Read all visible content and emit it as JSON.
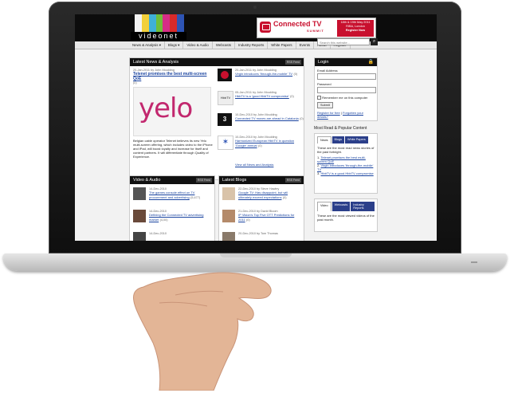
{
  "header": {
    "logo_text": "videonet",
    "logo_colors": [
      "#f3f3f3",
      "#f2d03a",
      "#3fb0d8",
      "#6fbf3a",
      "#d62e86",
      "#d82a2a",
      "#2e54b4"
    ],
    "banner": {
      "title": "Connected TV",
      "subtitle": "SUMMIT",
      "date": "18th & 19th May 2011",
      "venue": "RIBA, London",
      "cta": "Register Now"
    },
    "search_placeholder": "Search this website..."
  },
  "nav": [
    "News & Analysis",
    "Blogs",
    "Video & Audio",
    "Webcasts",
    "Industry Reports",
    "White Papers",
    "Events",
    "About",
    "Register"
  ],
  "latest_news": {
    "heading": "Latest News & Analysis",
    "rss_label": "RSS Feed",
    "featured": {
      "meta": "20-Jan-2011 by John Moulding",
      "headline": "Telenet promises the best multi-screen QoE",
      "count": "(0)",
      "image_word": "yelo",
      "body": "Belgian cable operator Telenet believes its new Yelo multi-screen offering, which includes video to the iPhone and iPad, will boost loyalty and increase for itself and content partners. It will differentiate through Quality of Experience."
    },
    "items": [
      {
        "meta": "20-Jan-2011 by John Moulding",
        "title": "Virgin introduces 'through-the-mobile' TV",
        "count": "(0)",
        "thumb": "virgin"
      },
      {
        "meta": "05-Jan-2011 by John Moulding",
        "title": "HbbTV is a 'good HbbTV compromise'",
        "count": "(0)",
        "thumb": "hbbtv"
      },
      {
        "meta": "10-Dec-2010 by John Moulding",
        "title": "Connected TV moves are ahead in Catalonia",
        "count": "(0)",
        "thumb": "tv3"
      },
      {
        "meta": "10-Dec-2010 by John Moulding",
        "title": "Harmonized European HbbTV in question 'Google' annual",
        "count": "(0)",
        "thumb": "star"
      }
    ],
    "more_link": "View all News and Analysis"
  },
  "video_audio": {
    "heading": "Video & Audio",
    "rss_label": "RSS Feed",
    "items": [
      {
        "meta": "14-Dec-2010",
        "title": "The games console effect on TV procurement and advertising",
        "count": "(5,477)"
      },
      {
        "meta": "14-Dec-2010",
        "title": "Defining the Connected TV advertising market",
        "count": "(4,00)"
      },
      {
        "meta": "14-Dec-2010",
        "title": "",
        "count": ""
      }
    ]
  },
  "latest_blogs": {
    "heading": "Latest Blogs",
    "rss_label": "RSS Feed",
    "items": [
      {
        "meta": "22-Dec-2010 by Steve Hawley",
        "title": "Google TV: Has disappoint, but will ultimately exceed expectations",
        "count": "(0)"
      },
      {
        "meta": "21-Dec-2010 by David Bloom",
        "title": "IP Vision's Top Five OTT Predictions for 2011",
        "count": "(0)"
      },
      {
        "meta": "20-Dec-2010 by Tom Thomas",
        "title": "",
        "count": ""
      }
    ]
  },
  "login": {
    "heading": "Login",
    "email_label": "Email Address",
    "password_label": "Password",
    "remember_label": "Remember me on this computer",
    "submit_label": "Submit",
    "register_text": "Register for free",
    "forgot_text": "Forgotten your details?"
  },
  "popular": {
    "heading": "Most Read & Popular Content",
    "tabs": [
      "News",
      "Blogs",
      "White Papers"
    ],
    "intro": "These are the most read news stories of the past fortnight.",
    "items": [
      "Telenet promises the best multi-screen QoE",
      "Virgin introduces 'through-the-mobile' TV",
      "HbbTV is a good HbbTV compromise"
    ],
    "tabs2": [
      "Video",
      "Webcasts",
      "Industry Reports"
    ],
    "intro2": "These are the most viewed videos of the past month."
  }
}
